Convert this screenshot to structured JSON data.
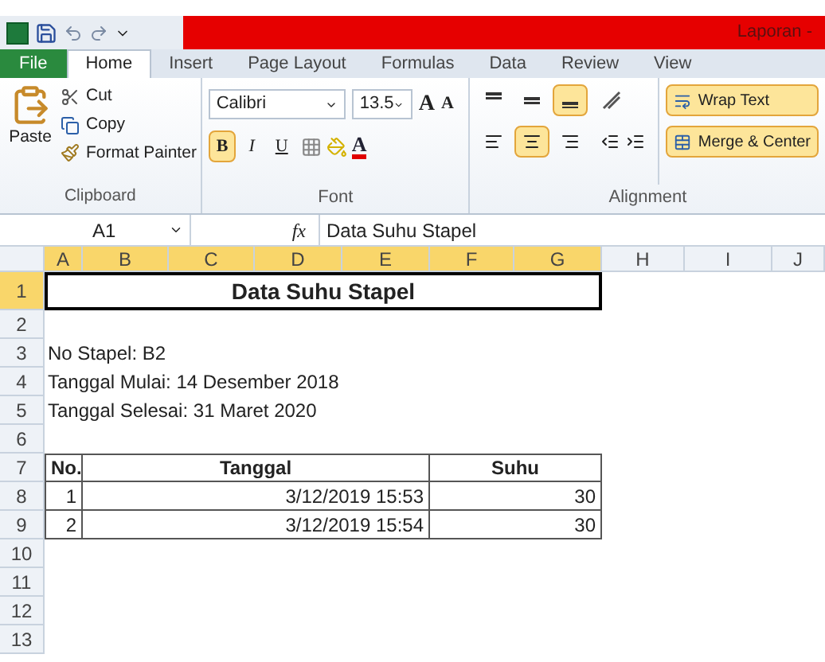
{
  "title_bar": {
    "title": "Laporan -"
  },
  "tabs": [
    {
      "label": "File",
      "kind": "file",
      "selected": false
    },
    {
      "label": "Home",
      "kind": "tab",
      "selected": true
    },
    {
      "label": "Insert",
      "kind": "tab",
      "selected": false
    },
    {
      "label": "Page Layout",
      "kind": "tab",
      "selected": false
    },
    {
      "label": "Formulas",
      "kind": "tab",
      "selected": false
    },
    {
      "label": "Data",
      "kind": "tab",
      "selected": false
    },
    {
      "label": "Review",
      "kind": "tab",
      "selected": false
    },
    {
      "label": "View",
      "kind": "tab",
      "selected": false
    }
  ],
  "clipboard": {
    "label": "Clipboard",
    "paste": "Paste",
    "cut": "Cut",
    "copy": "Copy",
    "format_painter": "Format Painter"
  },
  "font": {
    "label": "Font",
    "family": "Calibri",
    "size": "13.5",
    "grow": "A",
    "shrink": "A",
    "bold": {
      "label": "B",
      "selected": true
    },
    "italic": {
      "label": "I",
      "selected": false
    },
    "underline": {
      "label": "U",
      "selected": false
    },
    "color_letter": "A"
  },
  "alignment": {
    "label": "Alignment",
    "vertical": [
      {
        "selected": false
      },
      {
        "selected": false
      },
      {
        "selected": true
      }
    ],
    "horizontal": [
      {
        "selected": false
      },
      {
        "selected": true
      },
      {
        "selected": false
      }
    ],
    "wrap_text": {
      "label": "Wrap Text",
      "selected": true
    },
    "merge_center": {
      "label": "Merge & Center",
      "selected": true
    }
  },
  "formula_bar": {
    "name_box": "A1",
    "fx": "fx",
    "value": "Data Suhu Stapel"
  },
  "columns": [
    {
      "label": "A",
      "selected": true
    },
    {
      "label": "B",
      "selected": true
    },
    {
      "label": "C",
      "selected": true
    },
    {
      "label": "D",
      "selected": true
    },
    {
      "label": "E",
      "selected": true
    },
    {
      "label": "F",
      "selected": true
    },
    {
      "label": "G",
      "selected": true
    },
    {
      "label": "H",
      "selected": false
    },
    {
      "label": "I",
      "selected": false
    },
    {
      "label": "J",
      "selected": false
    }
  ],
  "rows": [
    {
      "header": "1",
      "selected": true,
      "kind": "title",
      "cells": [
        "Data Suhu Stapel"
      ]
    },
    {
      "header": "2",
      "selected": false,
      "kind": "blank",
      "cells": []
    },
    {
      "header": "3",
      "selected": false,
      "kind": "info",
      "cells": [
        "No Stapel: B2"
      ]
    },
    {
      "header": "4",
      "selected": false,
      "kind": "info",
      "cells": [
        "Tanggal Mulai: 14 Desember 2018"
      ]
    },
    {
      "header": "5",
      "selected": false,
      "kind": "info",
      "cells": [
        "Tanggal Selesai: 31 Maret 2020"
      ]
    },
    {
      "header": "6",
      "selected": false,
      "kind": "blank",
      "cells": []
    },
    {
      "header": "7",
      "selected": false,
      "kind": "table-head",
      "cells": [
        "No.",
        "Tanggal",
        "Suhu"
      ]
    },
    {
      "header": "8",
      "selected": false,
      "kind": "table-row",
      "cells": [
        "1",
        "3/12/2019 15:53",
        "30"
      ]
    },
    {
      "header": "9",
      "selected": false,
      "kind": "table-row",
      "cells": [
        "2",
        "3/12/2019 15:54",
        "30"
      ]
    },
    {
      "header": "10",
      "selected": false,
      "kind": "blank",
      "cells": []
    },
    {
      "header": "11",
      "selected": false,
      "kind": "blank",
      "cells": []
    },
    {
      "header": "12",
      "selected": false,
      "kind": "blank",
      "cells": []
    },
    {
      "header": "13",
      "selected": false,
      "kind": "blank",
      "cells": []
    }
  ]
}
